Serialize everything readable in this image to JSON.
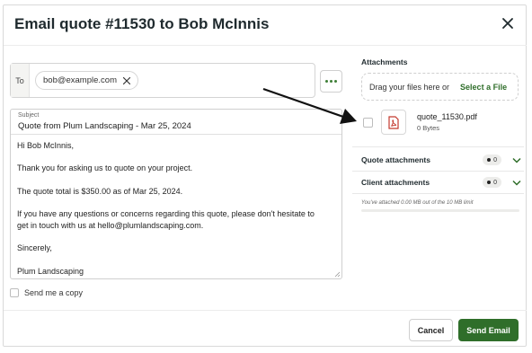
{
  "dialog": {
    "title": "Email quote #11530 to Bob McInnis"
  },
  "recipients": {
    "to_label": "To",
    "chips": [
      "bob@example.com"
    ]
  },
  "message": {
    "subject_label": "Subject",
    "subject": "Quote from Plum Landscaping - Mar 25, 2024",
    "body": [
      "Hi Bob McInnis,",
      "",
      "Thank you for asking us to quote on your project.",
      "",
      "The quote total is $350.00 as of Mar 25, 2024.",
      "",
      "If you have any questions or concerns regarding this quote, please don't hesitate to",
      "get in touch with us at hello@plumlandscaping.com.",
      "",
      "Sincerely,",
      "",
      "Plum Landscaping"
    ],
    "send_copy_label": "Send me a copy"
  },
  "attachments": {
    "title": "Attachments",
    "drop_text": "Drag your files here or",
    "select_file": "Select a File",
    "files": [
      {
        "name": "quote_11530.pdf",
        "size": "0 Bytes",
        "type_icon": "pdf-icon"
      }
    ],
    "sections": [
      {
        "label": "Quote attachments",
        "count": "0"
      },
      {
        "label": "Client attachments",
        "count": "0"
      }
    ],
    "limit_text": "You've attached 0.00 MB out of the 10 MB limit",
    "usage_fraction": 0.0
  },
  "footer": {
    "cancel": "Cancel",
    "send": "Send Email"
  },
  "colors": {
    "accent": "#2f6e2a",
    "pdf_red": "#c43a2f"
  }
}
